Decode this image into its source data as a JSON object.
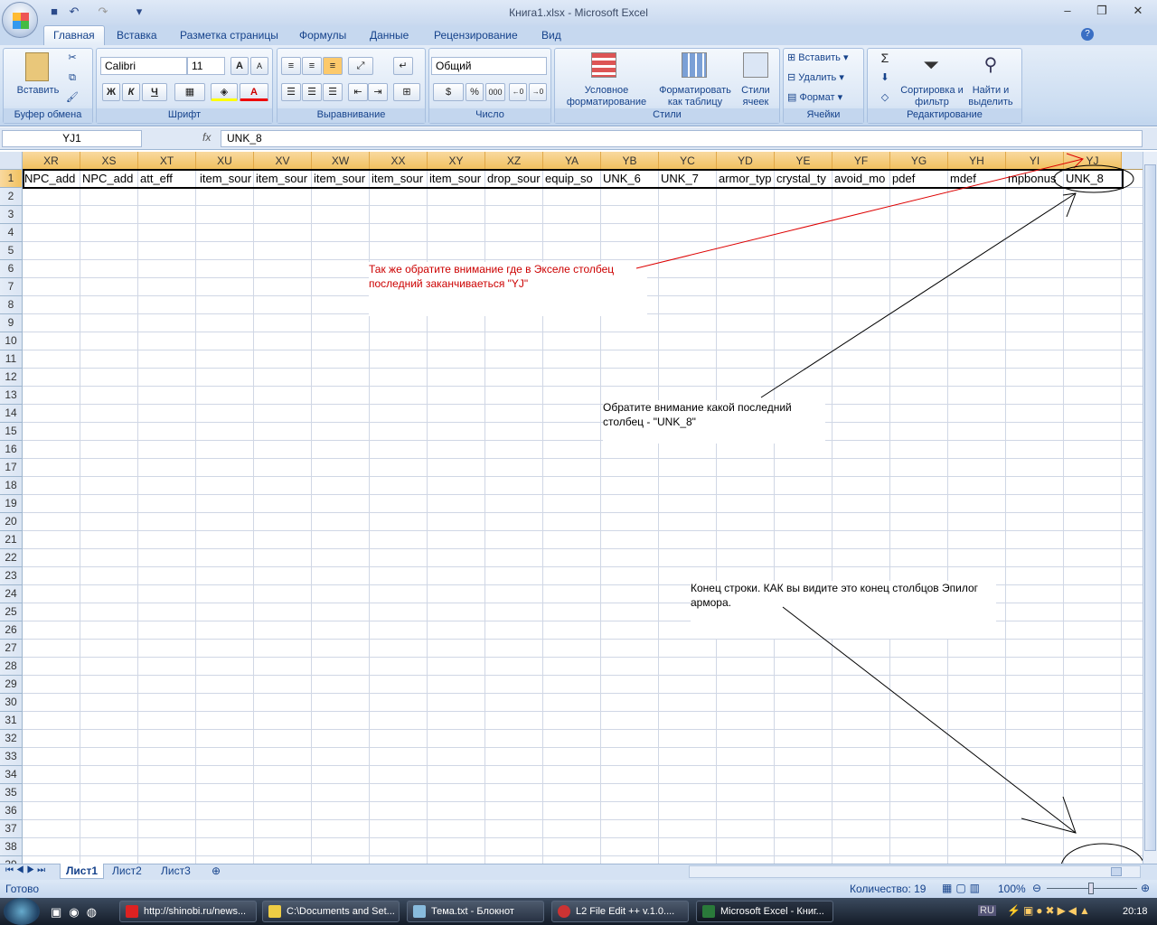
{
  "window": {
    "title": "Книга1.xlsx - Microsoft Excel"
  },
  "quick_access": {
    "save": "save-icon",
    "undo": "undo-icon",
    "redo": "redo-icon"
  },
  "tabs": [
    "Главная",
    "Вставка",
    "Разметка страницы",
    "Формулы",
    "Данные",
    "Рецензирование",
    "Вид"
  ],
  "ribbon": {
    "clipboard": {
      "label": "Буфер обмена",
      "paste": "Вставить"
    },
    "font": {
      "label": "Шрифт",
      "name": "Calibri",
      "size": "11",
      "bold": "Ж",
      "italic": "К",
      "underline": "Ч",
      "grow": "A",
      "shrink": "A",
      "color": "A"
    },
    "alignment": {
      "label": "Выравнивание"
    },
    "number": {
      "label": "Число",
      "format": "Общий",
      "percent": "%",
      "thousands": "000"
    },
    "styles": {
      "label": "Стили",
      "conditional": "Условное форматирование",
      "table": "Форматировать как таблицу",
      "cell": "Стили ячеек"
    },
    "cells": {
      "label": "Ячейки",
      "insert": "Вставить",
      "delete": "Удалить",
      "format": "Формат"
    },
    "editing": {
      "label": "Редактирование",
      "sum": "Σ",
      "sort": "Сортировка и фильтр",
      "find": "Найти и выделить"
    }
  },
  "formula_bar": {
    "name_box": "YJ1",
    "fx": "fx",
    "value": "UNK_8"
  },
  "columns": [
    "XR",
    "XS",
    "XT",
    "XU",
    "XV",
    "XW",
    "XX",
    "XY",
    "XZ",
    "YA",
    "YB",
    "YC",
    "YD",
    "YE",
    "YF",
    "YG",
    "YH",
    "YI",
    "YJ"
  ],
  "row1": [
    "NPC_add",
    "NPC_add",
    "att_eff",
    "item_sour",
    "item_sour",
    "item_sour",
    "item_sour",
    "item_sour",
    "drop_sour",
    "equip_so",
    "UNK_6",
    "UNK_7",
    "armor_typ",
    "crystal_ty",
    "avoid_mo",
    "pdef",
    "mdef",
    "mpbonus",
    "UNK_8"
  ],
  "row1_offsets": [
    0,
    0,
    0,
    2,
    0,
    0,
    0,
    0,
    0,
    0,
    0,
    0,
    0,
    0,
    0,
    0,
    0,
    0,
    0
  ],
  "row_count": 39,
  "annotations": {
    "note1": "Так же обратите внимание где в Экселе столбец последний заканчиваеться \"YJ\"",
    "note2": "Обратите внимание какой последний столбец - \"UNK_8\"",
    "note3": "Конец строки. КАК вы видите это конец столбцов Эпилог армора.",
    "note1_color": "#cc0000"
  },
  "sheets": [
    "Лист1",
    "Лист2",
    "Лист3"
  ],
  "active_sheet": "Лист1",
  "status": {
    "ready": "Готово",
    "count": "Количество: 19",
    "zoom": "100%"
  },
  "taskbar": {
    "items": [
      "http://shinobi.ru/news...",
      "C:\\Documents and Set...",
      "Тема.txt - Блокнот",
      "L2 File Edit ++ v.1.0....",
      "Microsoft Excel - Книг..."
    ],
    "lang": "RU",
    "clock": "20:18"
  }
}
